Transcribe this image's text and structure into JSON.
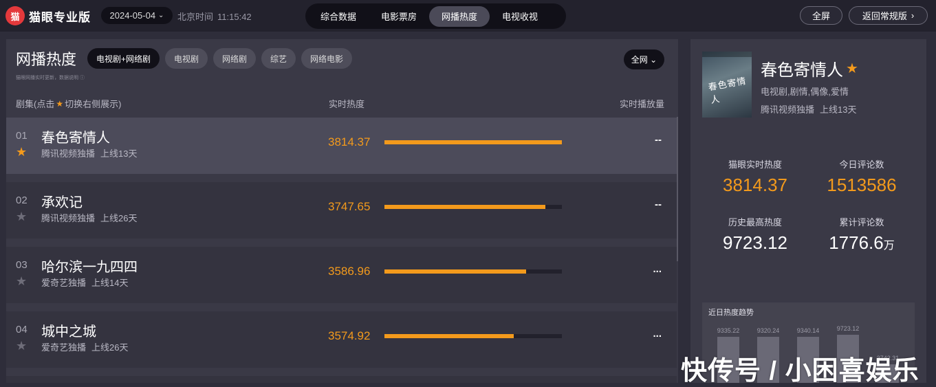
{
  "app": {
    "logo_glyph": "猫",
    "logo_text": "猫眼专业版"
  },
  "date": {
    "value": "2024-05-04",
    "chevron": "⌄"
  },
  "clock": {
    "label": "北京时间",
    "time": "11:15:42"
  },
  "nav": {
    "tabs": [
      {
        "label": "综合数据",
        "active": false
      },
      {
        "label": "电影票房",
        "active": false
      },
      {
        "label": "网播热度",
        "active": true
      },
      {
        "label": "电视收视",
        "active": false
      }
    ]
  },
  "topbar": {
    "fullscreen": "全屏",
    "back": "返回常规版",
    "back_arrow": "›"
  },
  "main": {
    "title": "网播热度",
    "note": "猫眼网播实时更新，数据说明 ⓘ",
    "filters": [
      "电视剧+网络剧",
      "电视剧",
      "网络剧",
      "综艺",
      "网络电影"
    ],
    "active_filter": "电视剧+网络剧",
    "scope": "全网 ⌄",
    "header": {
      "col1_prefix": "剧集(点击",
      "col1_suffix": "切换右侧展示)",
      "col2": "实时热度",
      "col3": "实时播放量"
    },
    "rows": [
      {
        "rank": "01",
        "name": "春色寄情人",
        "platform": "腾讯视频独播",
        "online": "上线13天",
        "heat": "3814.37",
        "bar": 1.0,
        "play": "--",
        "starred": true
      },
      {
        "rank": "02",
        "name": "承欢记",
        "platform": "腾讯视频独播",
        "online": "上线26天",
        "heat": "3747.65",
        "bar": 0.907,
        "play": "--",
        "starred": false
      },
      {
        "rank": "03",
        "name": "哈尔滨一九四四",
        "platform": "爱奇艺独播",
        "online": "上线14天",
        "heat": "3586.96",
        "bar": 0.8,
        "play": "...",
        "starred": false
      },
      {
        "rank": "04",
        "name": "城中之城",
        "platform": "爱奇艺独播",
        "online": "上线26天",
        "heat": "3574.92",
        "bar": 0.73,
        "play": "...",
        "starred": false
      }
    ]
  },
  "side": {
    "poster_text": "春色寄情人",
    "title": "春色寄情人",
    "genre": "电视剧,剧情,偶像,爱情",
    "platform": "腾讯视频独播",
    "online": "上线13天",
    "stats": [
      {
        "label": "猫眼实时热度",
        "value": "3814.37",
        "unit": "",
        "highlight": true
      },
      {
        "label": "今日评论数",
        "value": "1513586",
        "unit": "",
        "highlight": true
      },
      {
        "label": "历史最高热度",
        "value": "9723.12",
        "unit": "",
        "highlight": false
      },
      {
        "label": "累计评论数",
        "value": "1776.6",
        "unit": "万",
        "highlight": false
      }
    ],
    "trend": {
      "title": "近日热度趋势",
      "labels": [
        "9335.22",
        "9320.24",
        "9340.14",
        "9723.12",
        "3742.31"
      ],
      "values": [
        9335.22,
        9320.24,
        9340.14,
        9723.12,
        3742.31
      ]
    }
  },
  "watermark": "快传号 / 小困喜娱乐",
  "colors": {
    "accent": "#f39a1c",
    "panel": "#3a3946",
    "topbar": "#23222d"
  }
}
